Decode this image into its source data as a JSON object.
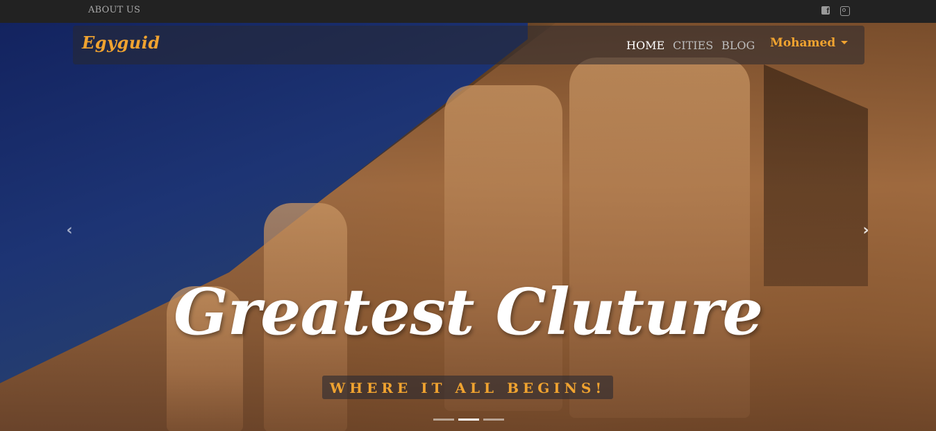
{
  "topbar": {
    "about_label": "ABOUT US",
    "social": [
      {
        "icon": "facebook-icon",
        "glyph": "f"
      },
      {
        "icon": "instagram-icon"
      }
    ]
  },
  "navbar": {
    "brand": "Egyguid",
    "links": [
      {
        "label": "HOME",
        "active": true
      },
      {
        "label": "CITIES",
        "active": false
      },
      {
        "label": "BLOG",
        "active": false
      }
    ],
    "user_menu": "Mohamed"
  },
  "carousel": {
    "headline": "Greatest Cluture",
    "tagline": "WHERE IT ALL BEGINS!",
    "prev_icon": "‹",
    "next_icon": "›",
    "indicator_count": 3,
    "active_indicator": 1
  },
  "colors": {
    "accent": "#f0a330",
    "topbar_bg": "#222222",
    "nav_active": "#ffffff",
    "nav_inactive": "#bdbdbd"
  }
}
